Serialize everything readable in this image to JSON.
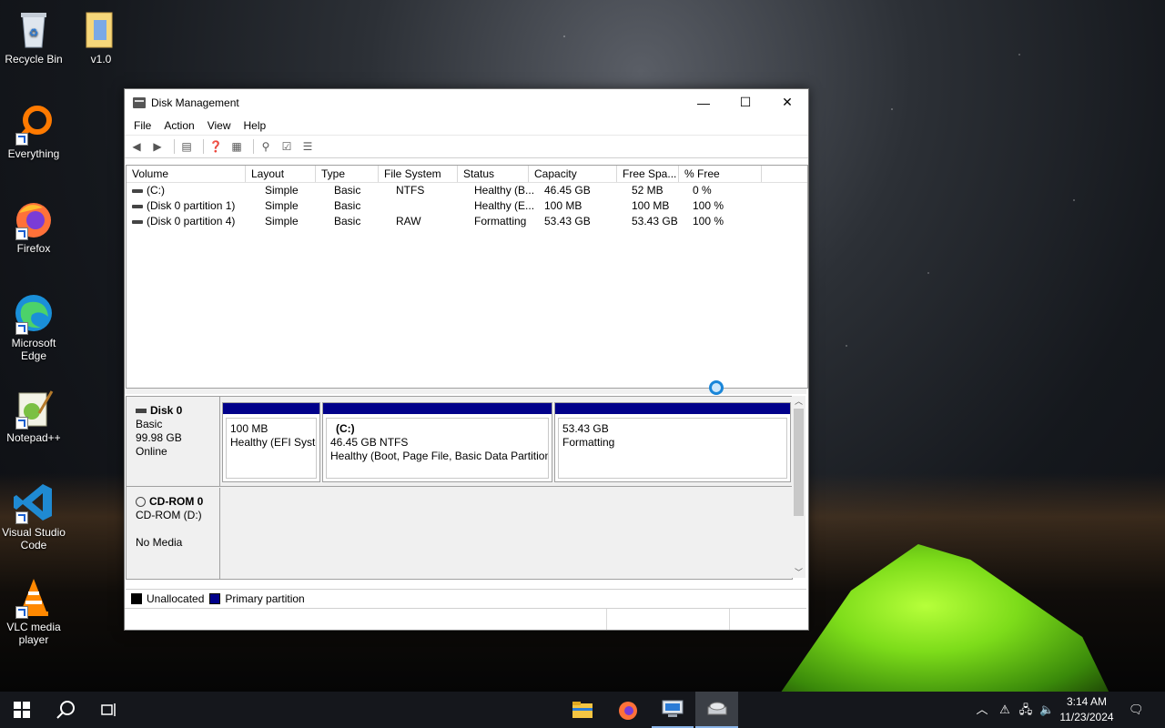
{
  "desktop": {
    "icons": [
      {
        "label": "Recycle Bin"
      },
      {
        "label": "v1.0"
      },
      {
        "label": "Everything"
      },
      {
        "label": "Firefox"
      },
      {
        "label": "Microsoft Edge"
      },
      {
        "label": "Notepad++"
      },
      {
        "label": "Visual Studio Code"
      },
      {
        "label": "VLC media player"
      }
    ]
  },
  "window": {
    "title": "Disk Management",
    "minimize_glyph": "—",
    "maximize_glyph": "☐",
    "close_glyph": "✕",
    "menu": [
      "File",
      "Action",
      "View",
      "Help"
    ],
    "columns": [
      "Volume",
      "Layout",
      "Type",
      "File System",
      "Status",
      "Capacity",
      "Free Spa...",
      "% Free"
    ],
    "volumes": [
      [
        "(C:)",
        "Simple",
        "Basic",
        "NTFS",
        "Healthy (B...",
        "46.45 GB",
        "52 MB",
        "0 %"
      ],
      [
        "(Disk 0 partition 1)",
        "Simple",
        "Basic",
        "",
        "Healthy (E...",
        "100 MB",
        "100 MB",
        "100 %"
      ],
      [
        "(Disk 0 partition 4)",
        "Simple",
        "Basic",
        "RAW",
        "Formatting",
        "53.43 GB",
        "53.43 GB",
        "100 %"
      ]
    ],
    "disks": [
      {
        "name": "Disk 0",
        "type": "Basic",
        "size": "99.98 GB",
        "state": "Online",
        "partitions": [
          {
            "title": "",
            "line1": "100 MB",
            "line2": "Healthy (EFI Syste"
          },
          {
            "title": "(C:)",
            "line1": "46.45 GB NTFS",
            "line2": "Healthy (Boot, Page File, Basic Data Partition)"
          },
          {
            "title": "",
            "line1": "53.43 GB",
            "line2": "Formatting"
          }
        ]
      },
      {
        "name": "CD-ROM 0",
        "type": "CD-ROM (D:)",
        "size": "",
        "state": "No Media"
      }
    ],
    "legend": [
      {
        "label": "Unallocated",
        "color": "#000000"
      },
      {
        "label": "Primary partition",
        "color": "#00008a"
      }
    ]
  },
  "taskbar": {
    "time": "3:14 AM",
    "date": "11/23/2024"
  },
  "colors": {
    "primary_partition": "#00008a",
    "accent": "#1a86d9"
  }
}
